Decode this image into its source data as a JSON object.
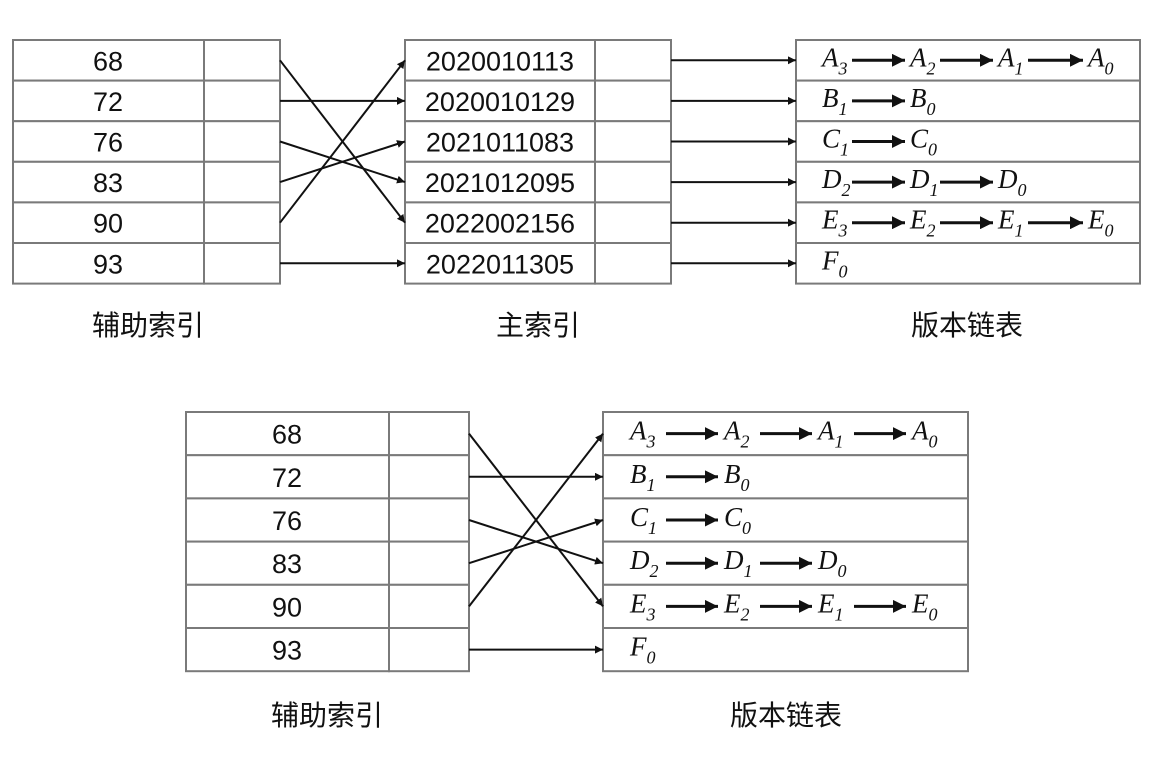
{
  "diagram1": {
    "secondary_index": {
      "caption": "辅助索引",
      "keys": [
        "68",
        "72",
        "76",
        "83",
        "90",
        "93"
      ]
    },
    "primary_index": {
      "caption": "主索引",
      "keys": [
        "2020010113",
        "2020010129",
        "2021011083",
        "2021012095",
        "2022002156",
        "2022011305"
      ]
    },
    "version_chain": {
      "caption": "版本链表",
      "rows": [
        [
          {
            "l": "A",
            "s": "3"
          },
          {
            "l": "A",
            "s": "2"
          },
          {
            "l": "A",
            "s": "1"
          },
          {
            "l": "A",
            "s": "0"
          }
        ],
        [
          {
            "l": "B",
            "s": "1"
          },
          {
            "l": "B",
            "s": "0"
          }
        ],
        [
          {
            "l": "C",
            "s": "1"
          },
          {
            "l": "C",
            "s": "0"
          }
        ],
        [
          {
            "l": "D",
            "s": "2"
          },
          {
            "l": "D",
            "s": "1"
          },
          {
            "l": "D",
            "s": "0"
          }
        ],
        [
          {
            "l": "E",
            "s": "3"
          },
          {
            "l": "E",
            "s": "2"
          },
          {
            "l": "E",
            "s": "1"
          },
          {
            "l": "E",
            "s": "0"
          }
        ],
        [
          {
            "l": "F",
            "s": "0"
          }
        ]
      ]
    },
    "secondary_to_primary": [
      4,
      1,
      3,
      2,
      0,
      5
    ]
  },
  "diagram2": {
    "secondary_index": {
      "caption": "辅助索引",
      "keys": [
        "68",
        "72",
        "76",
        "83",
        "90",
        "93"
      ]
    },
    "version_chain": {
      "caption": "版本链表",
      "rows": [
        [
          {
            "l": "A",
            "s": "3"
          },
          {
            "l": "A",
            "s": "2"
          },
          {
            "l": "A",
            "s": "1"
          },
          {
            "l": "A",
            "s": "0"
          }
        ],
        [
          {
            "l": "B",
            "s": "1"
          },
          {
            "l": "B",
            "s": "0"
          }
        ],
        [
          {
            "l": "C",
            "s": "1"
          },
          {
            "l": "C",
            "s": "0"
          }
        ],
        [
          {
            "l": "D",
            "s": "2"
          },
          {
            "l": "D",
            "s": "1"
          },
          {
            "l": "D",
            "s": "0"
          }
        ],
        [
          {
            "l": "E",
            "s": "3"
          },
          {
            "l": "E",
            "s": "2"
          },
          {
            "l": "E",
            "s": "1"
          },
          {
            "l": "E",
            "s": "0"
          }
        ],
        [
          {
            "l": "F",
            "s": "0"
          }
        ]
      ]
    },
    "secondary_to_chain": [
      4,
      1,
      3,
      2,
      0,
      5
    ]
  }
}
